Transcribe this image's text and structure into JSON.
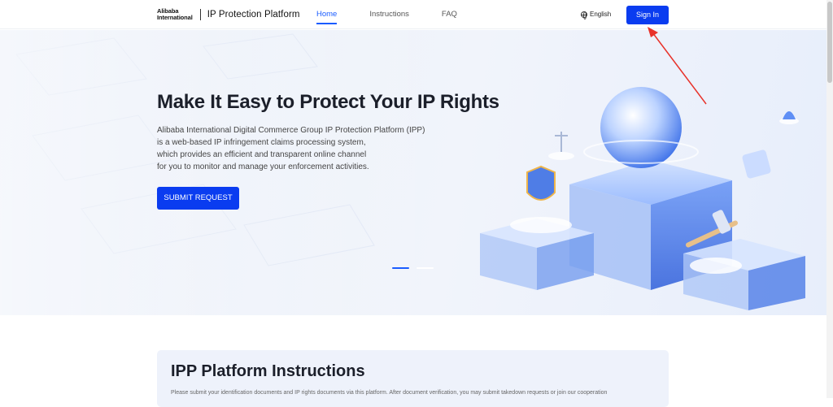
{
  "header": {
    "logo_line1": "Alibaba",
    "logo_line2": "International",
    "title": "IP Protection Platform",
    "nav": [
      {
        "label": "Home",
        "active": true
      },
      {
        "label": "Instructions",
        "active": false
      },
      {
        "label": "FAQ",
        "active": false
      }
    ],
    "language": "English",
    "signin_label": "Sign In"
  },
  "hero": {
    "title": "Make It Easy to Protect Your IP Rights",
    "description_lines": [
      "Alibaba International Digital Commerce Group IP Protection Platform (IPP)",
      "is a web-based IP infringement claims processing system,",
      "which provides an efficient and transparent online channel",
      "for you to monitor and manage your enforcement activities."
    ],
    "submit_label": "SUBMIT REQUEST",
    "carousel": {
      "slides": 2,
      "active": 1
    }
  },
  "instructions": {
    "title": "IPP Platform Instructions",
    "text": "Please submit your identification documents and IP rights documents via this platform. After document verification, you may submit takedown requests or join our cooperation"
  },
  "colors": {
    "accent": "#0a3cf0",
    "nav_active": "#1a5cff",
    "annotation_arrow": "#e8322a"
  },
  "icons": {
    "language": "globe-icon",
    "annotation": "red-arrow-annotation"
  }
}
